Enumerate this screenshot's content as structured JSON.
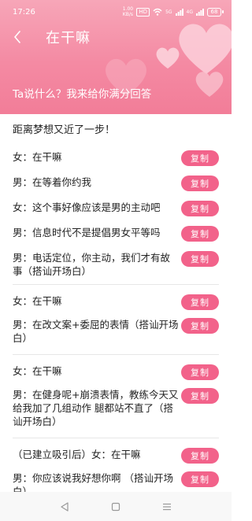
{
  "status_bar": {
    "time": "17:26",
    "speed": "1.00 KB/s",
    "hd": "HD",
    "network_1": "5G",
    "network_2": "4G",
    "battery": "68"
  },
  "header": {
    "title": "在干嘛",
    "subtitle": "Ta说什么？我来给你满分回答"
  },
  "intro": "距离梦想又近了一步！",
  "copy_label": "复制",
  "groups": [
    {
      "lines": [
        "女：在干嘛",
        "男：在等着你约我",
        "女：这个事好像应该是男的主动吧",
        "男：信息时代不是提倡男女平等吗",
        "男：电话定位，你主动，我们才有故事（搭讪开场白）"
      ]
    },
    {
      "lines": [
        "女：在干嘛",
        "男：在改文案+委屈的表情（搭讪开场白）"
      ]
    },
    {
      "lines": [
        "女：在干嘛",
        "男：在健身呢+崩溃表情，教练今天又给我加了几组动作 腿都站不直了（搭讪开场白）"
      ]
    },
    {
      "lines": [
        "（已建立吸引后）女：在干嘛",
        "男：你应该说我好想你啊 （搭讪开场白）"
      ]
    }
  ],
  "colors": {
    "accent": "#f2628a",
    "header_top": "#f7a6b8",
    "header_bottom": "#f27d98"
  }
}
